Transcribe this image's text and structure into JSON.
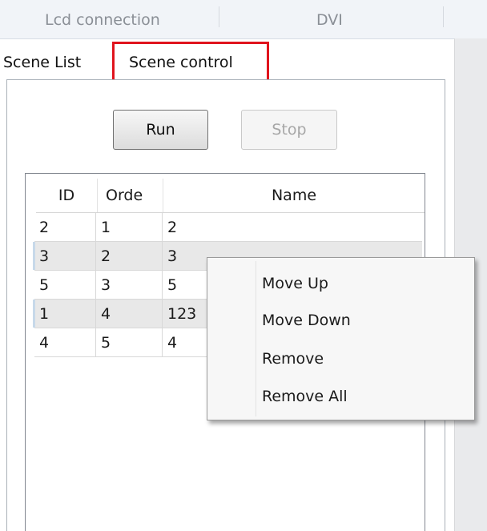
{
  "top_tabs": [
    "Lcd connection",
    "DVI"
  ],
  "tabs": [
    "Scene List",
    "Scene control"
  ],
  "active_tab": "Scene control",
  "buttons": {
    "run": "Run",
    "stop": "Stop"
  },
  "table": {
    "columns": [
      "ID",
      "Orde",
      "Name"
    ],
    "rows": [
      [
        "2",
        "1",
        "2"
      ],
      [
        "3",
        "2",
        "3"
      ],
      [
        "5",
        "3",
        "5"
      ],
      [
        "1",
        "4",
        "123"
      ],
      [
        "4",
        "5",
        "4"
      ]
    ]
  },
  "context_menu": [
    "Move Up",
    "Move Down",
    "Remove",
    "Remove All"
  ],
  "colors": {
    "highlight_box": "#e0141d"
  }
}
